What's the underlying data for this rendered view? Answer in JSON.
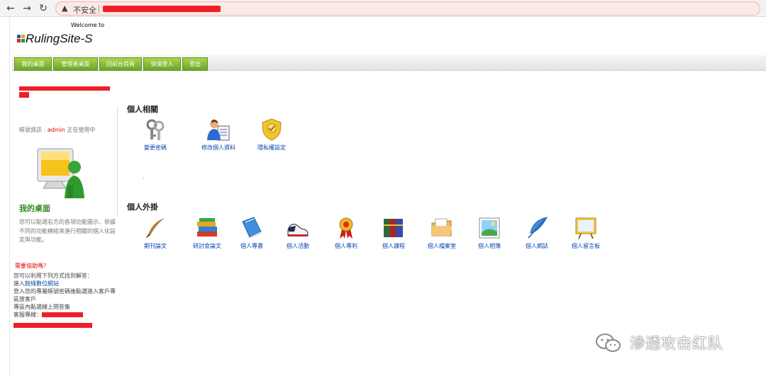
{
  "browser": {
    "security_label": "不安全"
  },
  "header": {
    "welcome": "Welcome to",
    "logo_text": "RulingSite-S",
    "logo_colors": [
      "#e2231a",
      "#1a9a3c",
      "#1b5fb4",
      "#f4a300"
    ]
  },
  "nav": {
    "tabs": [
      {
        "label": "我的桌面"
      },
      {
        "label": "管理者桌面"
      },
      {
        "label": "回前台首頁"
      },
      {
        "label": "快速登入"
      },
      {
        "label": "登出"
      }
    ],
    "accent_color": "#7bb52f"
  },
  "sidebar": {
    "account_prefix": "帳號資訊 :",
    "account_user": "admin",
    "account_suffix": "正在使用中",
    "desk_title": "我的桌面",
    "desk_desc": "您可以點選右方的各項功能圖示，依據不同的功能模組來進行相關的個人化設定與功能。",
    "help_title": "需要協助嗎？",
    "help_line1": "您可以利用下列方式找到解答：",
    "help_line2_prefix": "進入",
    "help_link": "銳綠數位網站",
    "help_line3": "登入您的專屬帳號密碼後點選進入客戶專區放客戶",
    "help_line4": "專區內點選線上問答集",
    "help_line5": "客服專線："
  },
  "main": {
    "personal_title": "個人相關",
    "personal_items": [
      {
        "label": "變更密碼",
        "icon": "keys-icon"
      },
      {
        "label": "修改個人資料",
        "icon": "profile-icon"
      },
      {
        "label": "隱私權設定",
        "icon": "privacy-shield-icon"
      }
    ],
    "plugins_title": "個人外掛",
    "plugin_items": [
      {
        "label": "期刊論文",
        "icon": "quill-pen-icon"
      },
      {
        "label": "研討會論文",
        "icon": "book-stack-icon"
      },
      {
        "label": "個人專書",
        "icon": "blue-book-icon"
      },
      {
        "label": "個人活動",
        "icon": "sneaker-icon"
      },
      {
        "label": "個人專利",
        "icon": "award-ribbon-icon"
      },
      {
        "label": "個人課程",
        "icon": "books-icon"
      },
      {
        "label": "個人檔案室",
        "icon": "folder-icon"
      },
      {
        "label": "個人相簿",
        "icon": "photo-icon"
      },
      {
        "label": "個人網誌",
        "icon": "feather-icon"
      },
      {
        "label": "個人留言板",
        "icon": "message-board-icon"
      }
    ]
  },
  "watermark": {
    "text": "滲透攻击红队"
  }
}
